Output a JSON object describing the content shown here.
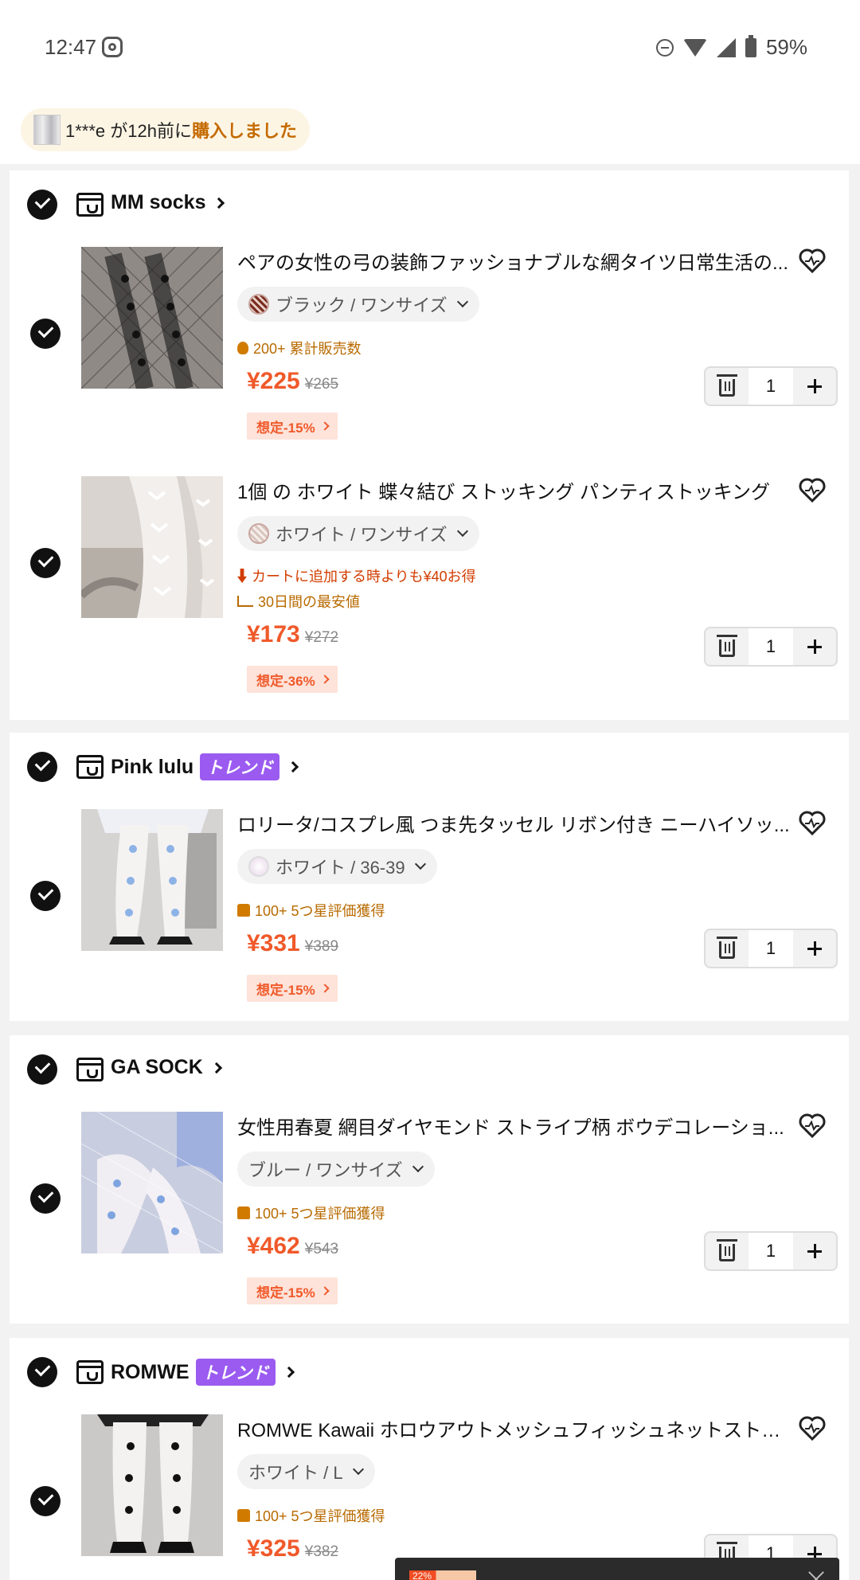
{
  "status_bar": {
    "time": "12:47",
    "battery": "59%"
  },
  "notice": {
    "text": "1***e が12h前に",
    "action": "購入しました"
  },
  "stores": [
    {
      "name": "MM socks",
      "trend": null,
      "items": [
        {
          "title": "ペアの女性の弓の装飾ファッショナブルな網タイツ日常生活の...",
          "variant": "ブラック / ワンサイズ",
          "meta": [
            "200+ 累計販売数"
          ],
          "price": "¥225",
          "original_price": "¥265",
          "discount": "想定-15%",
          "quantity": "1"
        },
        {
          "title": "1個 の ホワイト 蝶々結び ストッキング パンティストッキング",
          "variant": "ホワイト / ワンサイズ",
          "meta": [
            "カートに追加する時よりも¥40お得",
            "30日間の最安値"
          ],
          "price": "¥173",
          "original_price": "¥272",
          "discount": "想定-36%",
          "quantity": "1"
        }
      ]
    },
    {
      "name": "Pink lulu",
      "trend": "トレンド",
      "items": [
        {
          "title": "ロリータ/コスプレ風 つま先タッセル リボン付き ニーハイソッ...",
          "variant": "ホワイト / 36-39",
          "meta": [
            "100+ 5つ星評価獲得"
          ],
          "price": "¥331",
          "original_price": "¥389",
          "discount": "想定-15%",
          "quantity": "1"
        }
      ]
    },
    {
      "name": "GA SOCK",
      "trend": null,
      "items": [
        {
          "title": "女性用春夏 網目ダイヤモンド ストライプ柄 ボウデコレーショ...",
          "variant": "ブルー / ワンサイズ",
          "meta": [
            "100+ 5つ星評価獲得"
          ],
          "price": "¥462",
          "original_price": "¥543",
          "discount": "想定-15%",
          "quantity": "1"
        }
      ]
    },
    {
      "name": "ROMWE",
      "trend": "トレンド",
      "items": [
        {
          "title": "ROMWE Kawaii ホロウアウトメッシュフィッシュネットストッ...",
          "variant": "ホワイト / L",
          "meta": [
            "100+ 5つ星評価獲得"
          ],
          "price": "¥325",
          "original_price": "¥382",
          "discount": "",
          "quantity": "1"
        }
      ]
    }
  ],
  "popup": {
    "tag": "22%"
  },
  "colors": {
    "price": "#f0592a",
    "trend_badge": "#9b5bf0",
    "notice_bg": "#fdf5e4"
  }
}
